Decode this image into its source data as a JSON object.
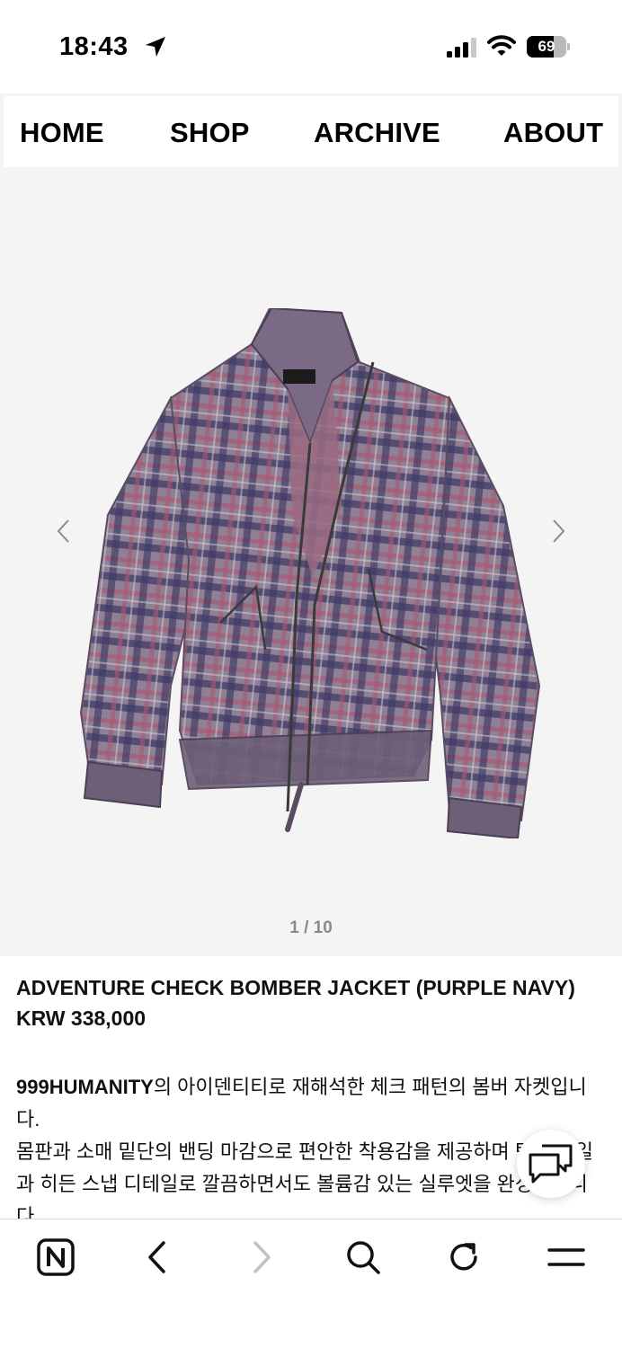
{
  "status_bar": {
    "time": "18:43",
    "battery_percent": "69",
    "battery_level": 0.69
  },
  "nav": {
    "items": [
      {
        "label": "HOME"
      },
      {
        "label": "SHOP"
      },
      {
        "label": "ARCHIVE"
      },
      {
        "label": "ABOUT"
      }
    ]
  },
  "gallery": {
    "image_icon": "plaid-bomber-jacket-photo",
    "counter": "1 / 10",
    "prev_icon": "chevron-left-icon",
    "next_icon": "chevron-right-icon"
  },
  "product": {
    "title": "ADVENTURE CHECK BOMBER JACKET (PURPLE NAVY)",
    "price": "KRW 338,000",
    "description_brand": "999HUMANITY",
    "description_rest": "의 아이덴티티로 재해석한 체크 패턴의 봄버 자켓입니다.",
    "description_line2": "몸판과 소매 밑단의 밴딩 마감으로 편안한 착용감을 제공하며 턱 디테일과 히든 스냅 디테일로 깔끔하면서도 볼륨감 있는 실루엣을 완성했습니다."
  },
  "chat": {
    "icon": "chat-bubbles-icon"
  },
  "toolbar": {
    "icons": [
      "naver-home-icon",
      "back-arrow-icon",
      "forward-arrow-icon",
      "search-icon",
      "refresh-icon",
      "menu-icon"
    ]
  },
  "colors": {
    "gallery_bg": "#f4f4f4",
    "text": "#111111",
    "counter": "#8a8a8a",
    "disabled": "#c2c2c2"
  }
}
